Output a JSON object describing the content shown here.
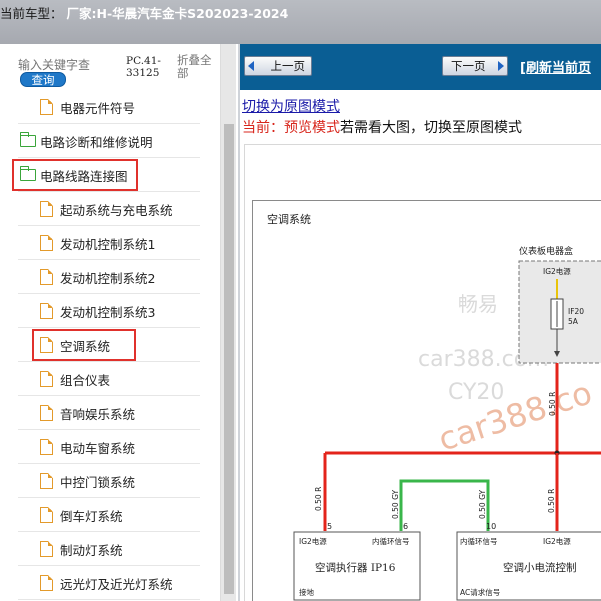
{
  "titlebar": {
    "label": "当前车型：",
    "value": "厂家:H-华晨汽车金卡S202023-2024"
  },
  "left": {
    "search_placeholder": "输入关键字查",
    "search_button": "查询",
    "pc_label": "PC.41-33125",
    "collapse_label": "折叠全部",
    "tree": [
      {
        "label": "电器元件符号",
        "icon": "document-icon",
        "level": 2
      },
      {
        "label": "电路诊断和维修说明",
        "icon": "folder-icon",
        "level": 1
      },
      {
        "label": "电路线路连接图",
        "icon": "folder-open-icon",
        "level": 1,
        "highlight": true
      },
      {
        "label": "起动系统与充电系统",
        "icon": "document-icon",
        "level": 2
      },
      {
        "label": "发动机控制系统1",
        "icon": "document-icon",
        "level": 2
      },
      {
        "label": "发动机控制系统2",
        "icon": "document-icon",
        "level": 2
      },
      {
        "label": "发动机控制系统3",
        "icon": "document-icon",
        "level": 2
      },
      {
        "label": "空调系统",
        "icon": "document-icon",
        "level": 2,
        "highlight": true
      },
      {
        "label": "组合仪表",
        "icon": "document-icon",
        "level": 2
      },
      {
        "label": "音响娱乐系统",
        "icon": "document-icon",
        "level": 2
      },
      {
        "label": "电动车窗系统",
        "icon": "document-icon",
        "level": 2
      },
      {
        "label": "中控门锁系统",
        "icon": "document-icon",
        "level": 2
      },
      {
        "label": "倒车灯系统",
        "icon": "document-icon",
        "level": 2
      },
      {
        "label": "制动灯系统",
        "icon": "document-icon",
        "level": 2
      },
      {
        "label": "远光灯及近光灯系统",
        "icon": "document-icon",
        "level": 2
      }
    ]
  },
  "right": {
    "prev_button": "上一页",
    "next_button": "下一页",
    "refresh_link": "[刷新当前页",
    "switch_mode_link": "切换为原图模式",
    "current_label": "当前：",
    "current_mode": "预览模式",
    "mode_hint": "若需看大图，切换至原图模式"
  },
  "diagram": {
    "title": "空调系统",
    "fusebox_title": "仪表板电器盒",
    "ig2_power_top": "IG2电源",
    "fuse_name": "IF20",
    "fuse_rating": "5A",
    "wire_main": "0.50 R",
    "wire_left": "0.50 R",
    "wire_gy1": "0.50 GY",
    "wire_gy2": "0.50 GY",
    "wire_right": "0.50 R",
    "pin_5": "5",
    "pin_6": "6",
    "pin_10": "10",
    "left_ig2": "IG2电源",
    "left_signal": "内循环信号",
    "left_module": "空调执行器 IP16",
    "left_ground": "接地",
    "right_signal": "内循环信号",
    "right_ig2": "IG2电源",
    "right_module": "空调小电流控制",
    "right_ac": "AC请求信号",
    "watermarks": [
      "畅易",
      "car388.com",
      "CY20",
      "car388.co"
    ],
    "colors": {
      "red_wire": "#e3241b",
      "green_wire": "#39b64a",
      "yellow_wire": "#e9c40a"
    }
  }
}
